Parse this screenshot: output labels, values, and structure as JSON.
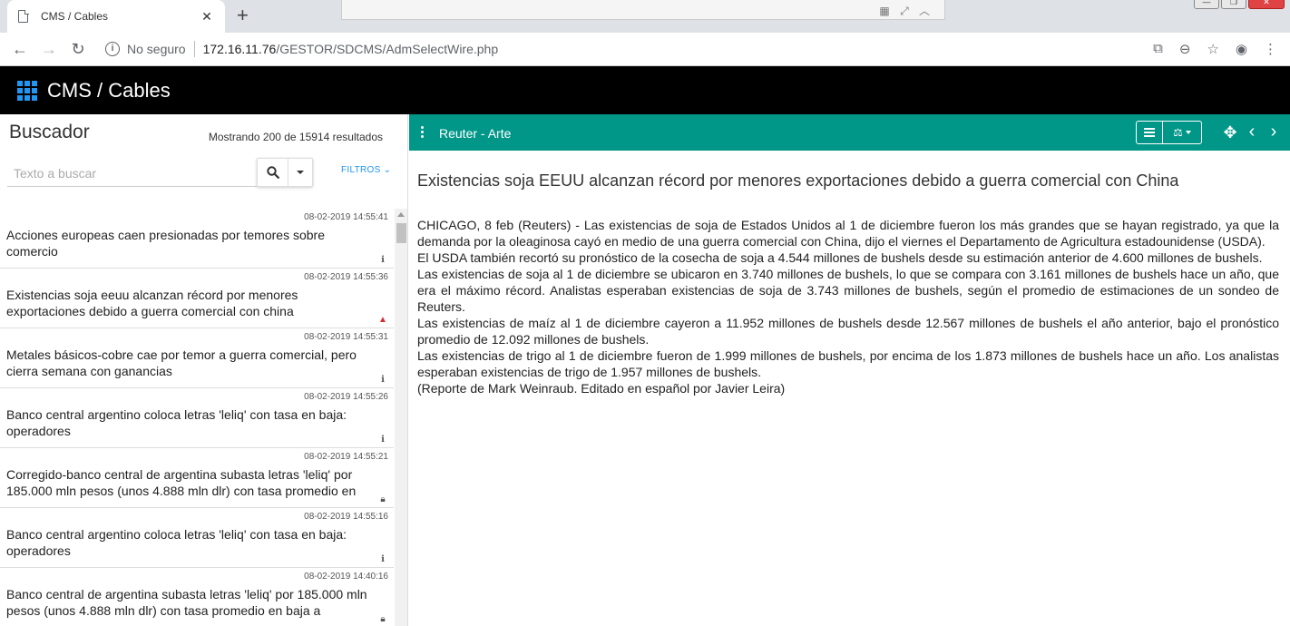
{
  "browser": {
    "tab_title": "CMS / Cables",
    "tab_close": "✕",
    "new_tab": "+",
    "security_label": "No seguro",
    "url_host": "172.16.11.76",
    "url_path": "/GESTOR/SDCMS/AdmSelectWire.php"
  },
  "app": {
    "title": "CMS / Cables",
    "accent_color": "#009688",
    "brand_icon_color": "#2196f3"
  },
  "search": {
    "title": "Buscador",
    "result_count": "Mostrando 200 de 15914 resultados",
    "placeholder": "Texto a buscar",
    "filters_label": "FILTROS"
  },
  "news_list": [
    {
      "time": "08-02-2019 14:55:41",
      "title": "Acciones europeas caen presionadas por temores sobre comercio",
      "icon": "info-icon"
    },
    {
      "time": "08-02-2019 14:55:36",
      "title": "Existencias soja eeuu alcanzan récord por menores exportaciones debido a guerra comercial con china",
      "icon": "warning-icon"
    },
    {
      "time": "08-02-2019 14:55:31",
      "title": "Metales básicos-cobre cae por temor a guerra comercial, pero cierra semana con ganancias",
      "icon": "info-icon"
    },
    {
      "time": "08-02-2019 14:55:26",
      "title": "Banco central argentino coloca letras 'leliq' con tasa en baja: operadores",
      "icon": "info-icon"
    },
    {
      "time": "08-02-2019 14:55:21",
      "title": "Corregido-banco central de argentina subasta letras 'leliq' por 185.000 mln pesos (unos 4.888 mln dlr) con tasa promedio en",
      "icon": "lock-icon"
    },
    {
      "time": "08-02-2019 14:55:16",
      "title": "Banco central argentino coloca letras 'leliq' con tasa en baja: operadores",
      "icon": "info-icon"
    },
    {
      "time": "08-02-2019 14:40:16",
      "title": "Banco central de argentina subasta letras 'leliq' por 185.000 mln pesos (unos 4.888 mln dlr) con tasa promedio en baja a",
      "icon": "lock-icon"
    }
  ],
  "viewer": {
    "source": "Reuter - Arte",
    "title": "Existencias soja EEUU alcanzan récord por menores exportaciones debido a guerra comercial con China",
    "paragraphs": [
      "CHICAGO, 8 feb (Reuters) - Las existencias de soja de Estados Unidos al 1 de diciembre fueron los más grandes que se hayan registrado, ya que la demanda por la oleaginosa cayó en medio de una guerra comercial con China, dijo el viernes el Departamento de Agricultura estadounidense (USDA).",
      "El USDA también recortó su pronóstico de la cosecha de soja a 4.544 millones de bushels desde su estimación anterior de 4.600 millones de bushels.",
      "Las existencias de soja al 1 de diciembre se ubicaron en 3.740 millones de bushels, lo que se compara con 3.161 millones de bushels hace un año, que era el máximo récord. Analistas esperaban existencias de soja de 3.743 millones de bushels, según el promedio de estimaciones de un sondeo de Reuters.",
      "Las existencias de maíz al 1 de diciembre cayeron a 11.952 millones de bushels desde 12.567 millones de bushels el año anterior, bajo el pronóstico promedio de 12.092 millones de bushels.",
      "Las existencias de trigo al 1 de diciembre fueron de 1.999 millones de bushels, por encima de los 1.873 millones de bushels hace un año. Los analistas esperaban existencias de trigo de 1.957 millones de bushels.",
      "(Reporte de Mark Weinraub. Editado en español por Javier Leira)"
    ]
  }
}
